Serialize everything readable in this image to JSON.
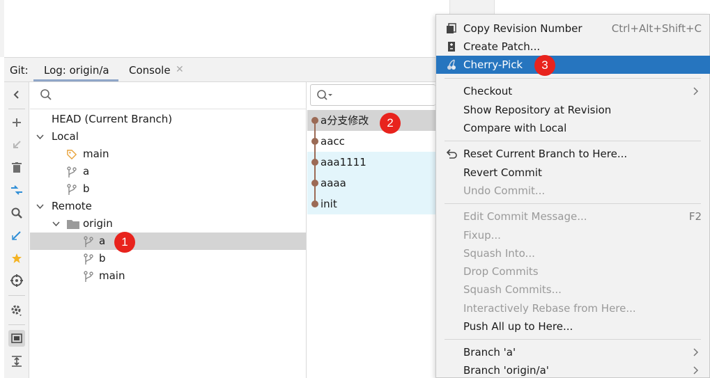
{
  "toolwindow": {
    "git_label": "Git:",
    "tabs": [
      {
        "label": "Log: origin/a"
      },
      {
        "label": "Console"
      }
    ],
    "console_close": "✕"
  },
  "branches": {
    "search_placeholder": "",
    "head": "HEAD (Current Branch)",
    "local_label": "Local",
    "local_branches": [
      {
        "label": "main"
      },
      {
        "label": "a"
      },
      {
        "label": "b"
      }
    ],
    "remote_label": "Remote",
    "remote_origin": "origin",
    "remote_branches": [
      {
        "label": "a"
      },
      {
        "label": "b"
      },
      {
        "label": "main"
      }
    ]
  },
  "commits": {
    "search_placeholder": "",
    "items": [
      {
        "message": "a分支修改"
      },
      {
        "message": "aacc"
      },
      {
        "message": "aaa1111"
      },
      {
        "message": "aaaa"
      },
      {
        "message": "init"
      }
    ]
  },
  "badges": {
    "one": "1",
    "two": "2",
    "three": "3"
  },
  "menu": {
    "copy_revision": {
      "label": "Copy Revision Number",
      "shortcut": "Ctrl+Alt+Shift+C"
    },
    "create_patch": {
      "label": "Create Patch..."
    },
    "cherry_pick": {
      "label": "Cherry-Pick"
    },
    "checkout": {
      "label": "Checkout"
    },
    "show_repo": {
      "label": "Show Repository at Revision"
    },
    "compare_local": {
      "label": "Compare with Local"
    },
    "reset_branch": {
      "label": "Reset Current Branch to Here..."
    },
    "revert_commit": {
      "label": "Revert Commit"
    },
    "undo_commit": {
      "label": "Undo Commit..."
    },
    "edit_message": {
      "label": "Edit Commit Message...",
      "shortcut": "F2"
    },
    "fixup": {
      "label": "Fixup..."
    },
    "squash_into": {
      "label": "Squash Into..."
    },
    "drop_commits": {
      "label": "Drop Commits"
    },
    "squash_commits": {
      "label": "Squash Commits..."
    },
    "interactive_rebase": {
      "label": "Interactively Rebase from Here..."
    },
    "push_all": {
      "label": "Push All up to Here..."
    },
    "branch_a": {
      "label": "Branch 'a'"
    },
    "branch_origin_a": {
      "label": "Branch 'origin/a'"
    }
  },
  "colors": {
    "menu_highlight": "#2675bf",
    "badge": "#e8231d",
    "graph": "#9b6a55",
    "commit_highlight": "#e3f5fb",
    "tag_icon": "#e8a33c"
  }
}
